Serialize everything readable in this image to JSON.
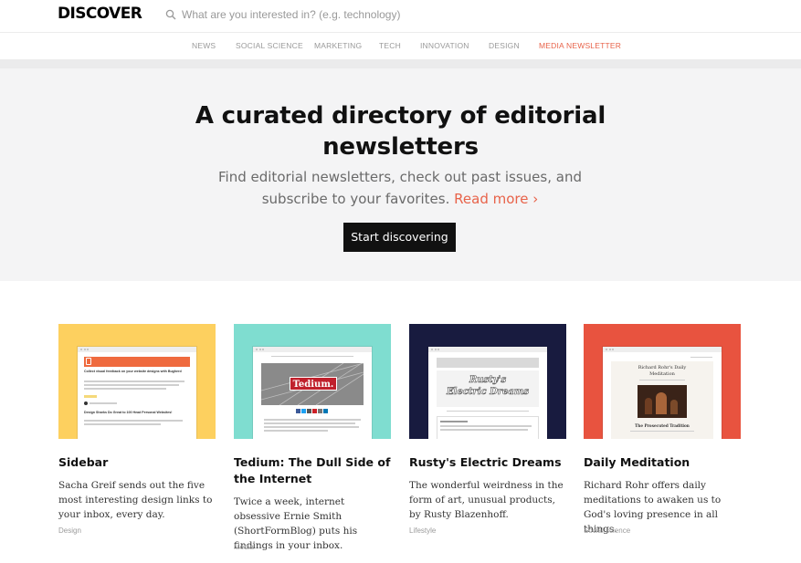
{
  "brand": {
    "logo": "DISCOVER"
  },
  "search": {
    "placeholder": "What are you interested in? (e.g. technology)"
  },
  "nav": {
    "items": [
      {
        "label": "NEWS"
      },
      {
        "label": "SOCIAL SCIENCE"
      },
      {
        "label": "MARKETING"
      },
      {
        "label": "TECH"
      },
      {
        "label": "INNOVATION"
      },
      {
        "label": "DESIGN"
      },
      {
        "label": "MEDIA NEWSLETTER"
      }
    ],
    "active_color": "#e8634a"
  },
  "hero": {
    "title_line1": "A curated directory of editorial",
    "title_line2": "newsletters",
    "subtitle": "Find editorial newsletters, check out past issues, and subscribe to your favorites.",
    "read_more": "Read more ›",
    "cta": "Start discovering"
  },
  "cards": [
    {
      "title": "Sidebar",
      "description": "Sacha Greif sends out the five most interesting design links to your inbox, every day.",
      "category": "Design",
      "bg_color": "#fdd05f",
      "thumb_headline": "Collect visual feedback on your website designs with Bugherd",
      "thumb_item2": "Design Sharks Do Great to 100 Head Personal Websites!"
    },
    {
      "title": "Tedium: The Dull Side of the Internet",
      "description": "Twice a week, internet obsessive Ernie Smith (ShortFormBlog) puts his findings in your inbox.",
      "category": "Media",
      "bg_color": "#7fddd0",
      "thumb_logo": "Tedium."
    },
    {
      "title": "Rusty's Electric Dreams",
      "description": "The wonderful weirdness in the form of art, unusual products, by Rusty Blazenhoff.",
      "category": "Lifestyle",
      "bg_color": "#181b3f",
      "thumb_logo_line1": "Rusty's",
      "thumb_logo_line2": "Electric Dreams"
    },
    {
      "title": "Daily Meditation",
      "description": "Richard Rohr offers daily meditations to awaken us to God's loving presence in all things.",
      "category": "Social science",
      "bg_color": "#e8533f",
      "thumb_title_line1": "Richard Rohr's Daily",
      "thumb_title_line2": "Meditation",
      "thumb_caption": "The Prosecuted Tradition"
    }
  ]
}
